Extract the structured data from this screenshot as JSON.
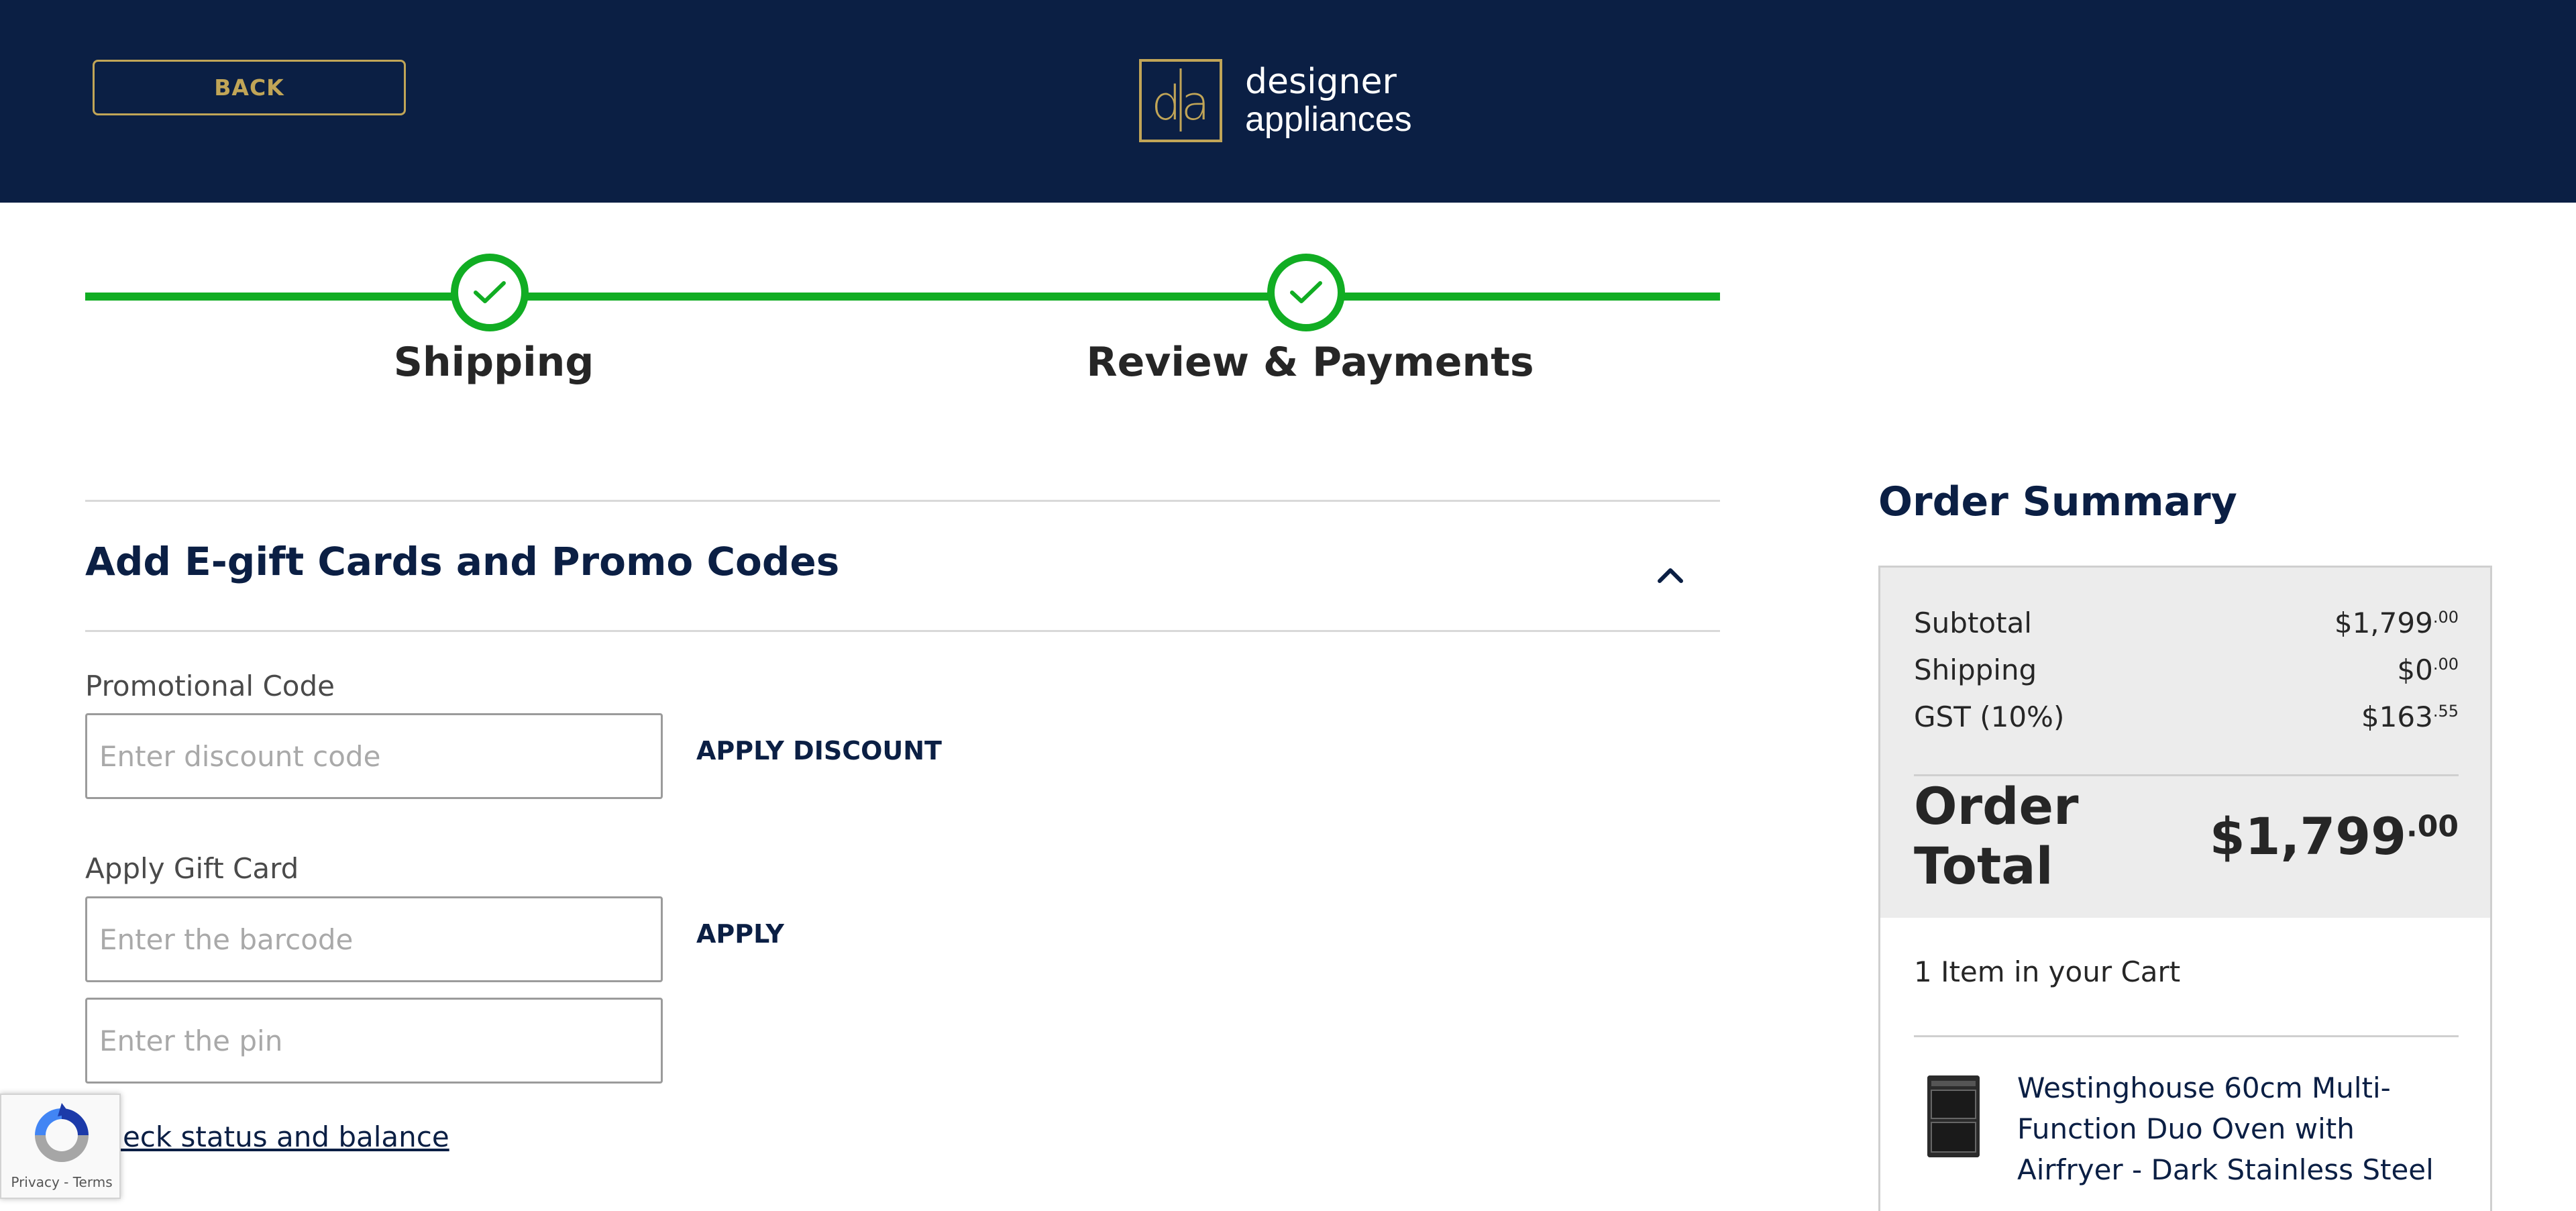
{
  "header": {
    "back_label": "BACK",
    "logo": {
      "mark": "da",
      "line1": "designer",
      "line2": "appliances",
      "accent": "#c1a557"
    },
    "background": "#0b1f44"
  },
  "progress": {
    "color": "#11ad23",
    "steps": [
      {
        "label": "Shipping",
        "icon": "checkmark-icon",
        "complete": true
      },
      {
        "label": "Review & Payments",
        "icon": "checkmark-icon",
        "complete": true
      }
    ]
  },
  "promo_section": {
    "title": "Add E-gift Cards and Promo Codes",
    "toggle_icon": "chevron-up-icon",
    "promo": {
      "label": "Promotional Code",
      "placeholder": "Enter discount code",
      "value": "",
      "button": "APPLY DISCOUNT"
    },
    "gift_card": {
      "label": "Apply Gift Card",
      "barcode_placeholder": "Enter the barcode",
      "pin_placeholder": "Enter the pin",
      "button": "APPLY",
      "check_link": "Check status and balance"
    }
  },
  "recaptcha": {
    "links": "Privacy - Terms",
    "icon": "recaptcha-icon"
  },
  "order_summary": {
    "title": "Order Summary",
    "rows": [
      {
        "label": "Subtotal",
        "whole": "$1,799",
        "cents": "00"
      },
      {
        "label": "Shipping",
        "whole": "$0",
        "cents": "00"
      },
      {
        "label": "GST (10%)",
        "whole": "$163",
        "cents": "55"
      }
    ],
    "total": {
      "label": "Order Total",
      "whole": "$1,799",
      "cents": "00"
    },
    "cart_count": "1 Item in your Cart",
    "items": [
      {
        "name": "Westinghouse 60cm Multi-Function Duo Oven with Airfryer - Dark Stainless Steel",
        "thumb_icon": "oven-icon"
      }
    ]
  }
}
